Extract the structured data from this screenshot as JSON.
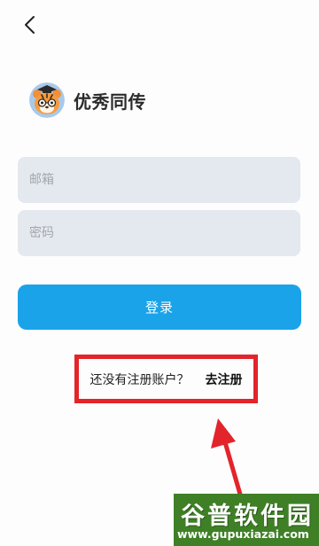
{
  "header": {
    "back_icon": "chevron-left-icon"
  },
  "brand": {
    "logo": "tiger-mascot-logo",
    "name": "优秀同传"
  },
  "form": {
    "email_placeholder": "邮箱",
    "email_value": "",
    "password_placeholder": "密码",
    "password_value": "",
    "login_label": "登录"
  },
  "register": {
    "prompt": "还没有注册账户？",
    "link_label": "去注册",
    "highlight_color": "#e3242b"
  },
  "colors": {
    "accent": "#1aa3e8",
    "field_bg": "#e4e8ef",
    "annotation": "#e3242b"
  },
  "watermark": {
    "main": "谷普软件园",
    "sub": "www.gupuxiazai.com"
  }
}
